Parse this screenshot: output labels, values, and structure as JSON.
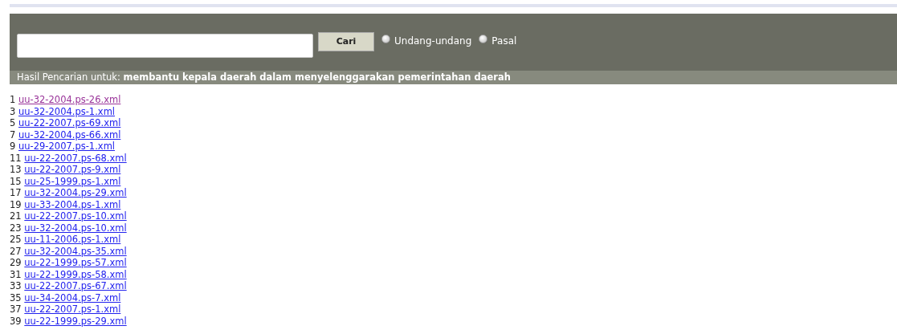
{
  "search": {
    "button": "Cari",
    "options": [
      {
        "label": "Undang-undang",
        "selected": false
      },
      {
        "label": "Pasal",
        "selected": false
      }
    ]
  },
  "result_header": {
    "label": "Hasil Pencarian untuk:",
    "query": "membantu kepala daerah dalam menyelenggarakan pemerintahan daerah"
  },
  "results": [
    {
      "number": "1",
      "link": "uu-32-2004.ps-26.xml",
      "visited": true
    },
    {
      "number": "3",
      "link": "uu-32-2004.ps-1.xml",
      "visited": false
    },
    {
      "number": "5",
      "link": "uu-22-2007.ps-69.xml",
      "visited": false
    },
    {
      "number": "7",
      "link": "uu-32-2004.ps-66.xml",
      "visited": false
    },
    {
      "number": "9",
      "link": "uu-29-2007.ps-1.xml",
      "visited": false
    },
    {
      "number": "11",
      "link": "uu-22-2007.ps-68.xml",
      "visited": false
    },
    {
      "number": "13",
      "link": "uu-22-2007.ps-9.xml",
      "visited": false
    },
    {
      "number": "15",
      "link": "uu-25-1999.ps-1.xml",
      "visited": false
    },
    {
      "number": "17",
      "link": "uu-32-2004.ps-29.xml",
      "visited": false
    },
    {
      "number": "19",
      "link": "uu-33-2004.ps-1.xml",
      "visited": false
    },
    {
      "number": "21",
      "link": "uu-22-2007.ps-10.xml",
      "visited": false
    },
    {
      "number": "23",
      "link": "uu-32-2004.ps-10.xml",
      "visited": false
    },
    {
      "number": "25",
      "link": "uu-11-2006.ps-1.xml",
      "visited": false
    },
    {
      "number": "27",
      "link": "uu-32-2004.ps-35.xml",
      "visited": false
    },
    {
      "number": "29",
      "link": "uu-22-1999.ps-57.xml",
      "visited": false
    },
    {
      "number": "31",
      "link": "uu-22-1999.ps-58.xml",
      "visited": false
    },
    {
      "number": "33",
      "link": "uu-22-2007.ps-67.xml",
      "visited": false
    },
    {
      "number": "35",
      "link": "uu-34-2004.ps-7.xml",
      "visited": false
    },
    {
      "number": "37",
      "link": "uu-22-2007.ps-1.xml",
      "visited": false
    },
    {
      "number": "39",
      "link": "uu-22-1999.ps-29.xml",
      "visited": false
    }
  ]
}
